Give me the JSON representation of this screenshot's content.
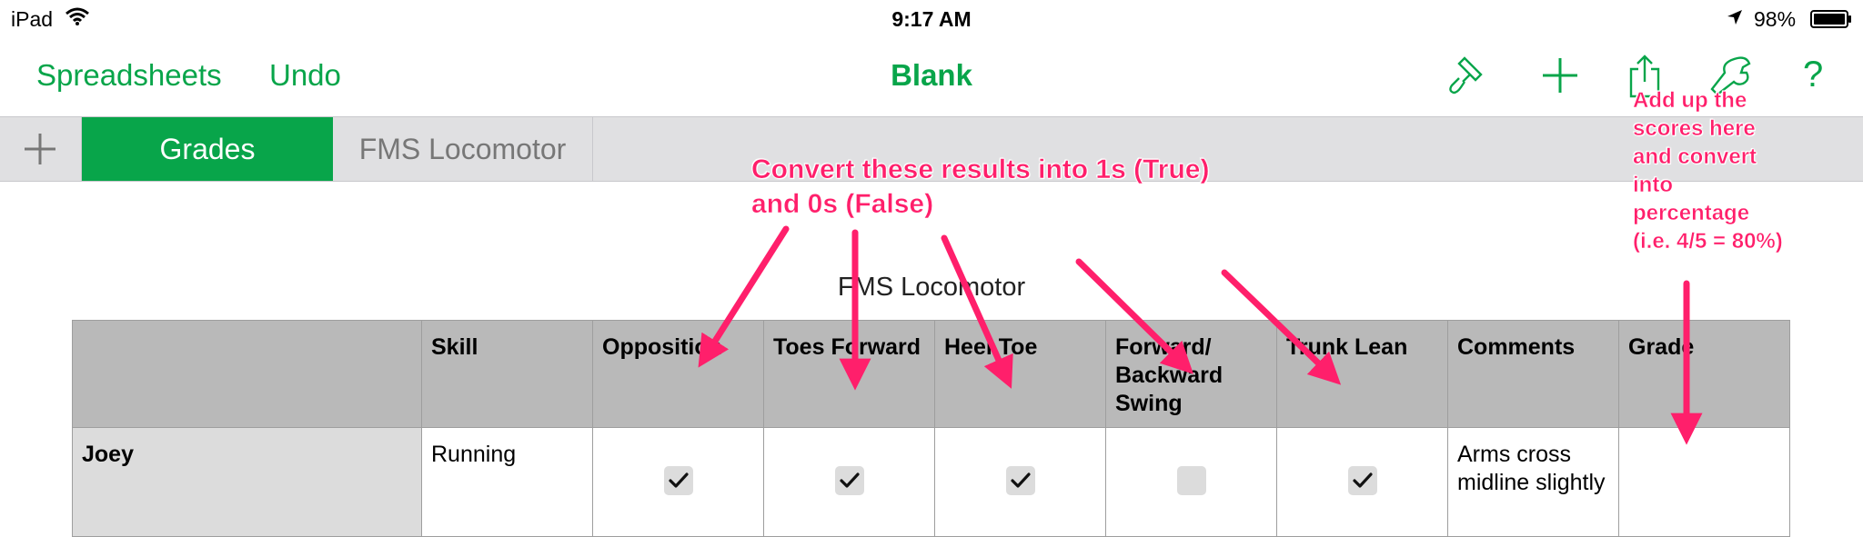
{
  "status_bar": {
    "device": "iPad",
    "time": "9:17 AM",
    "battery": "98%"
  },
  "toolbar": {
    "spreadsheets_label": "Spreadsheets",
    "undo_label": "Undo",
    "document_title": "Blank",
    "help_label": "?",
    "icons": [
      "paintbrush-icon",
      "plus-icon",
      "share-icon",
      "wrench-icon",
      "help-icon"
    ],
    "accent_color": "#08a54a"
  },
  "tabs": [
    {
      "label": "Grades",
      "active": true
    },
    {
      "label": "FMS Locomotor",
      "active": false
    }
  ],
  "sheet": {
    "table_title": "FMS Locomotor",
    "columns": [
      "",
      "Skill",
      "Opposition",
      "Toes Forward",
      "Heel Toe",
      "Forward/ Backward Swing",
      "Trunk Lean",
      "Comments",
      "Grade"
    ],
    "rows": [
      {
        "name": "Joey",
        "skill": "Running",
        "checks": [
          true,
          true,
          true,
          false,
          true
        ],
        "comments": "Arms cross midline slightly",
        "grade": ""
      }
    ]
  },
  "annotations": {
    "convert_note": "Convert these results into 1s (True) and 0s (False)",
    "addup_note": "Add up the scores here and convert into percentage (i.e. 4/5 = 80%)",
    "color": "#ff1f6b"
  }
}
